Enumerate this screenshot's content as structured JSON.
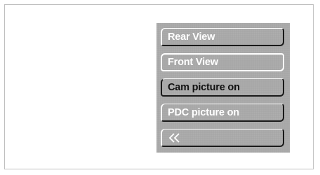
{
  "menu": {
    "items": [
      {
        "label": "Rear View"
      },
      {
        "label": "Front View"
      },
      {
        "label": "Cam picture on"
      },
      {
        "label": "PDC picture on"
      }
    ],
    "back_icon": "double-chevron-left-icon"
  },
  "colors": {
    "panel": "#a7a7a7",
    "text_light": "#ffffff",
    "text_dark": "#111111"
  }
}
